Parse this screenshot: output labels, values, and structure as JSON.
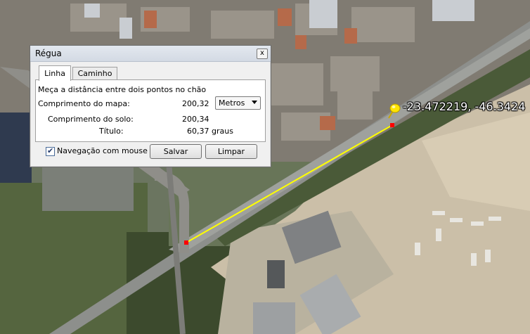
{
  "map": {
    "coordinate_label": "-23.472219, -46.3424",
    "pin_icon": "yellow-pushpin-icon"
  },
  "dialog": {
    "title": "Régua",
    "close_symbol": "x",
    "tabs": [
      {
        "label": "Linha",
        "active": true
      },
      {
        "label": "Caminho",
        "active": false
      }
    ],
    "instruction": "Meça a distância entre dois pontos no chão",
    "map_length_label": "Comprimento do mapa:",
    "map_length_value": "200,32",
    "unit_selected": "Metros",
    "ground_length_label": "Comprimento do solo:",
    "ground_length_value": "200,34",
    "heading_label": "Título:",
    "heading_value": "60,37 graus",
    "mouse_nav_label": "Navegação com mouse",
    "mouse_nav_checked": true,
    "save_label": "Salvar",
    "clear_label": "Limpar"
  },
  "colors": {
    "measure_line": "#ffff00",
    "endpoint": "#ff0000"
  }
}
